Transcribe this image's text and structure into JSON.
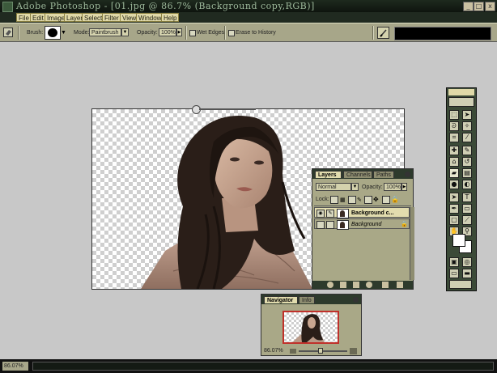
{
  "window": {
    "title": "Adobe Photoshop - [01.jpg @ 86.7% (Background copy,RGB)]",
    "minimize_label": "_",
    "maximize_label": "□",
    "close_label": "x"
  },
  "menu": [
    "File",
    "Edit",
    "Image",
    "Layer",
    "Select",
    "Filter",
    "View",
    "Window",
    "Help"
  ],
  "options_bar": {
    "brush_label": "Brush:",
    "mode_label": "Mode:",
    "mode_value": "Paintbrush",
    "opacity_label": "Opacity:",
    "opacity_value": "100%",
    "wet_edges_label": "Wet Edges",
    "erase_to_history_label": "Erase to History"
  },
  "layers_palette": {
    "tabs": [
      "Layers",
      "Channels",
      "Paths"
    ],
    "blend_mode": "Normal",
    "opacity_label": "Opacity:",
    "opacity_value": "100%",
    "lock_label": "Lock:",
    "layers": [
      {
        "name": "Background c...",
        "active": true
      },
      {
        "name": "Background",
        "active": false
      }
    ]
  },
  "navigator": {
    "tabs": [
      "Navigator",
      "Info"
    ],
    "zoom_value": "86.07%"
  },
  "status_bar": {
    "zoom_value": "86.07%"
  },
  "colors": {
    "chrome_dark": "#1e2a1e",
    "panel": "#a9a887",
    "menu_item": "#e0d9a8",
    "active_layer": "#e2dcae",
    "nav_frame": "#c0302a"
  }
}
